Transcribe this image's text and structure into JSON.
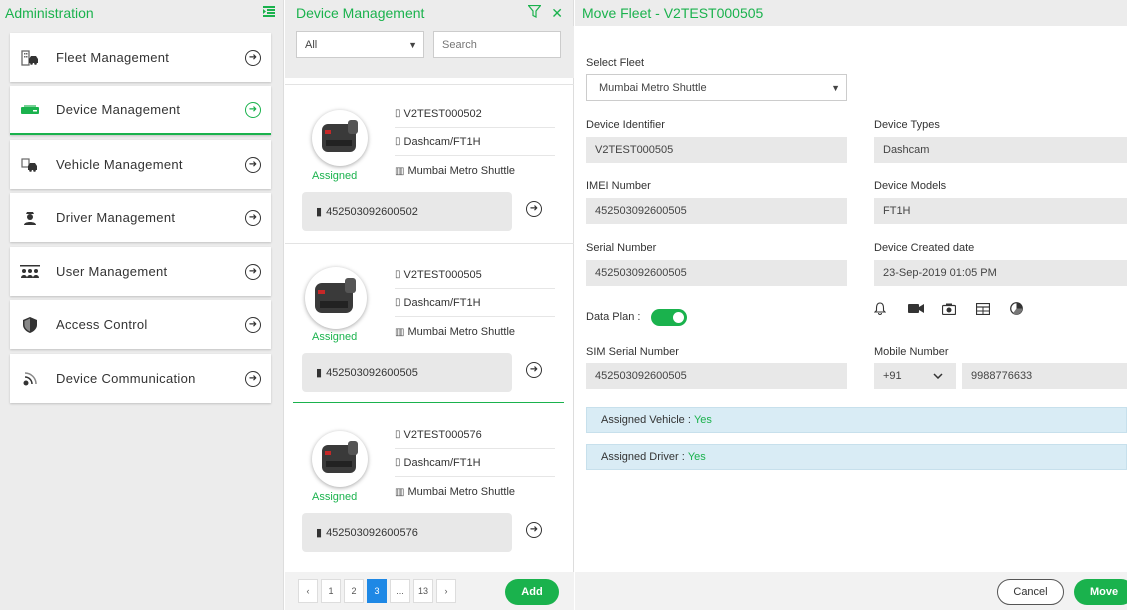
{
  "colors": {
    "accent": "#1ab24d",
    "pager_current": "#1e88e5",
    "info_bar": "#d9ecf5"
  },
  "admin": {
    "title": "Administration",
    "menu_icon": "list-collapse-icon",
    "items": [
      {
        "label": "Fleet Management",
        "icon": "building-car-icon"
      },
      {
        "label": "Device Management",
        "icon": "device-icon"
      },
      {
        "label": "Vehicle Management",
        "icon": "vehicle-icon"
      },
      {
        "label": "Driver Management",
        "icon": "driver-icon"
      },
      {
        "label": "User Management",
        "icon": "users-icon"
      },
      {
        "label": "Access Control",
        "icon": "shield-icon"
      },
      {
        "label": "Device Communication",
        "icon": "signal-icon"
      }
    ]
  },
  "devices": {
    "title": "Device Management",
    "filter_value": "All",
    "search_placeholder": "Search",
    "cards": [
      {
        "id": "V2TEST000502",
        "type": "Dashcam/FT1H",
        "fleet": "Mumbai Metro Shuttle",
        "status": "Assigned",
        "imei": "452503092600502"
      },
      {
        "id": "V2TEST000505",
        "type": "Dashcam/FT1H",
        "fleet": "Mumbai Metro Shuttle",
        "status": "Assigned",
        "imei": "452503092600505"
      },
      {
        "id": "V2TEST000576",
        "type": "Dashcam/FT1H",
        "fleet": "Mumbai Metro Shuttle",
        "status": "Assigned",
        "imei": "452503092600576"
      }
    ],
    "pager": {
      "prev": "‹",
      "pages": [
        "1",
        "2",
        "3",
        "...",
        "13"
      ],
      "current": "3",
      "next": "›"
    },
    "add_label": "Add"
  },
  "move_fleet": {
    "title": "Move Fleet - V2TEST000505",
    "select_fleet_label": "Select Fleet",
    "select_fleet_value": "Mumbai Metro Shuttle",
    "device_identifier_label": "Device Identifier",
    "device_identifier": "V2TEST000505",
    "device_types_label": "Device Types",
    "device_types": "Dashcam",
    "imei_label": "IMEI Number",
    "imei": "452503092600505",
    "device_models_label": "Device Models",
    "device_models": "FT1H",
    "serial_label": "Serial Number",
    "serial": "452503092600505",
    "created_label": "Device Created date",
    "created": "23-Sep-2019 01:05 PM",
    "data_plan_label": "Data Plan :",
    "data_plan_on": true,
    "sim_label": "SIM Serial Number",
    "sim": "452503092600505",
    "mobile_label": "Mobile Number",
    "mobile_code": "+91",
    "mobile": "9988776633",
    "assigned_vehicle_label": "Assigned Vehicle : ",
    "assigned_vehicle": "Yes",
    "assigned_driver_label": "Assigned Driver : ",
    "assigned_driver": "Yes",
    "cancel_label": "Cancel",
    "move_label": "Move"
  }
}
